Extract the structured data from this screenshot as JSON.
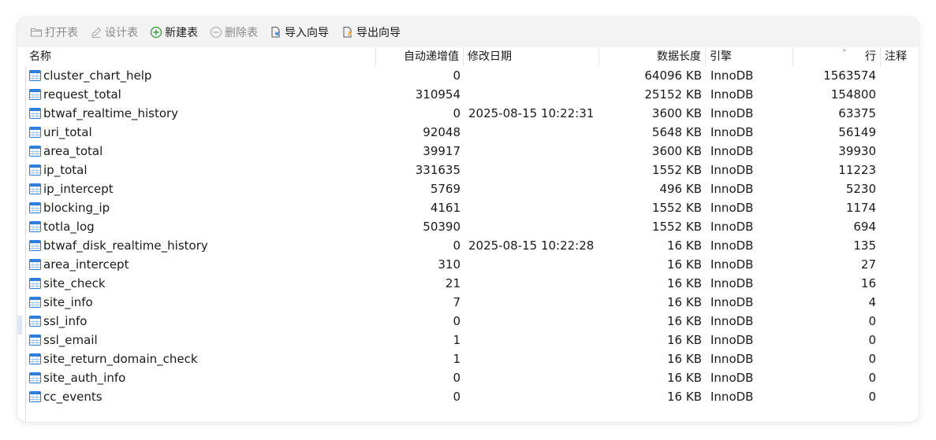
{
  "toolbar": {
    "open_table": "打开表",
    "design_table": "设计表",
    "new_table": "新建表",
    "delete_table": "删除表",
    "import_wizard": "导入向导",
    "export_wizard": "导出向导",
    "icons": {
      "open": "folder-icon",
      "design": "pencil-icon",
      "new": "plus-circle-icon",
      "delete": "minus-circle-icon",
      "import": "import-icon",
      "export": "export-icon"
    },
    "colors": {
      "new_icon": "#2e9d3a",
      "import_icon": "#2e7bd4",
      "export_icon": "#e59a1e"
    }
  },
  "columns": {
    "name": "名称",
    "auto_increment": "自动递增值",
    "modified": "修改日期",
    "data_length": "数据长度",
    "engine": "引擎",
    "rows": "行",
    "comment": "注释"
  },
  "table_icon_color": "#2f7fd8",
  "tables": [
    {
      "name": "cluster_chart_help",
      "auto_inc": "0",
      "modified": "",
      "size": "64096 KB",
      "engine": "InnoDB",
      "rows": "1563574"
    },
    {
      "name": "request_total",
      "auto_inc": "310954",
      "modified": "",
      "size": "25152 KB",
      "engine": "InnoDB",
      "rows": "154800"
    },
    {
      "name": "btwaf_realtime_history",
      "auto_inc": "0",
      "modified": "2025-08-15 10:22:31",
      "size": "3600 KB",
      "engine": "InnoDB",
      "rows": "63375"
    },
    {
      "name": "uri_total",
      "auto_inc": "92048",
      "modified": "",
      "size": "5648 KB",
      "engine": "InnoDB",
      "rows": "56149"
    },
    {
      "name": "area_total",
      "auto_inc": "39917",
      "modified": "",
      "size": "3600 KB",
      "engine": "InnoDB",
      "rows": "39930"
    },
    {
      "name": "ip_total",
      "auto_inc": "331635",
      "modified": "",
      "size": "1552 KB",
      "engine": "InnoDB",
      "rows": "11223"
    },
    {
      "name": "ip_intercept",
      "auto_inc": "5769",
      "modified": "",
      "size": "496 KB",
      "engine": "InnoDB",
      "rows": "5230"
    },
    {
      "name": "blocking_ip",
      "auto_inc": "4161",
      "modified": "",
      "size": "1552 KB",
      "engine": "InnoDB",
      "rows": "1174"
    },
    {
      "name": "totla_log",
      "auto_inc": "50390",
      "modified": "",
      "size": "1552 KB",
      "engine": "InnoDB",
      "rows": "694"
    },
    {
      "name": "btwaf_disk_realtime_history",
      "auto_inc": "0",
      "modified": "2025-08-15 10:22:28",
      "size": "16 KB",
      "engine": "InnoDB",
      "rows": "135"
    },
    {
      "name": "area_intercept",
      "auto_inc": "310",
      "modified": "",
      "size": "16 KB",
      "engine": "InnoDB",
      "rows": "27"
    },
    {
      "name": "site_check",
      "auto_inc": "21",
      "modified": "",
      "size": "16 KB",
      "engine": "InnoDB",
      "rows": "16"
    },
    {
      "name": "site_info",
      "auto_inc": "7",
      "modified": "",
      "size": "16 KB",
      "engine": "InnoDB",
      "rows": "4"
    },
    {
      "name": "ssl_info",
      "auto_inc": "0",
      "modified": "",
      "size": "16 KB",
      "engine": "InnoDB",
      "rows": "0"
    },
    {
      "name": "ssl_email",
      "auto_inc": "1",
      "modified": "",
      "size": "16 KB",
      "engine": "InnoDB",
      "rows": "0"
    },
    {
      "name": "site_return_domain_check",
      "auto_inc": "1",
      "modified": "",
      "size": "16 KB",
      "engine": "InnoDB",
      "rows": "0"
    },
    {
      "name": "site_auth_info",
      "auto_inc": "0",
      "modified": "",
      "size": "16 KB",
      "engine": "InnoDB",
      "rows": "0"
    },
    {
      "name": "cc_events",
      "auto_inc": "0",
      "modified": "",
      "size": "16 KB",
      "engine": "InnoDB",
      "rows": "0"
    }
  ]
}
